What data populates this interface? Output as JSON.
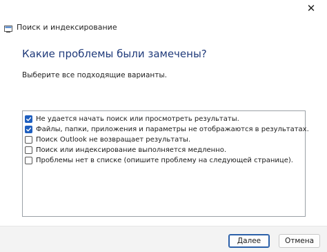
{
  "window": {
    "title": "Поиск и индексирование",
    "close_glyph": "✕"
  },
  "main": {
    "heading": "Какие проблемы были замечены?",
    "instruction": "Выберите все подходящие варианты."
  },
  "options": [
    {
      "label": "Не удается начать поиск или просмотреть результаты.",
      "checked": true
    },
    {
      "label": "Файлы, папки, приложения и параметры не отображаются в результатах.",
      "checked": true
    },
    {
      "label": "Поиск Outlook не возвращает результаты.",
      "checked": false
    },
    {
      "label": "Поиск или индексирование выполняется медленно.",
      "checked": false
    },
    {
      "label": "Проблемы нет в списке (опишите проблему на следующей странице).",
      "checked": false
    }
  ],
  "footer": {
    "next_label": "Далее",
    "cancel_label": "Отмена"
  },
  "colors": {
    "heading": "#1f3a7a",
    "checkbox_checked": "#1f5fbf",
    "footer_bg": "#f3f3f3"
  }
}
